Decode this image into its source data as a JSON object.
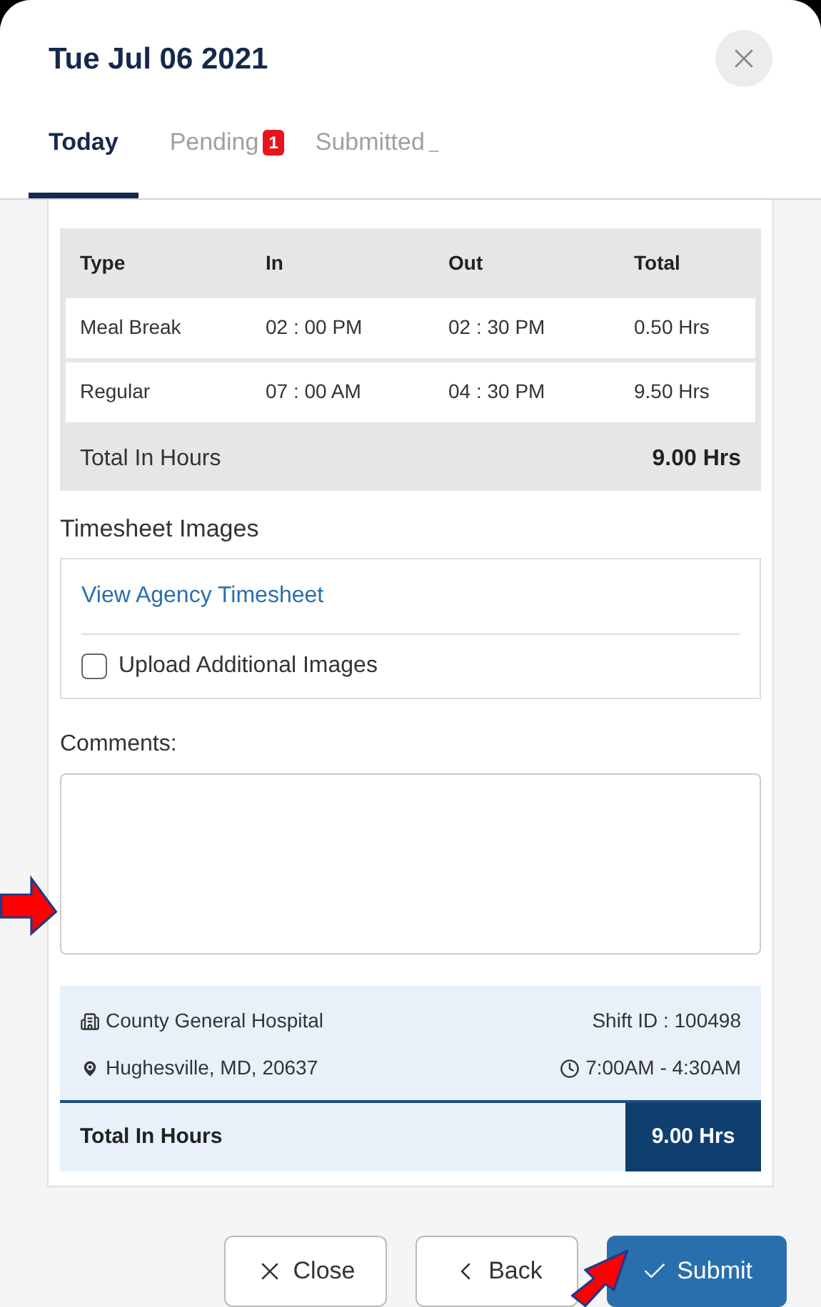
{
  "dialog": {
    "title": "Tue Jul 06 2021"
  },
  "tabs": [
    {
      "label": "Today",
      "selected": true
    },
    {
      "label": "Pending",
      "selected": false,
      "badge": "1"
    },
    {
      "label": "Submitted",
      "selected": false,
      "badge": "_"
    }
  ],
  "table": {
    "columns": [
      "Type",
      "In",
      "Out",
      "Total"
    ],
    "rows": [
      [
        "Meal Break",
        "02 : 00 PM",
        "02 : 30 PM",
        "0.50 Hrs"
      ],
      [
        "Regular",
        "07 : 00 AM",
        "04 : 30 PM",
        "9.50 Hrs"
      ]
    ],
    "footer": {
      "label": "Total In Hours",
      "value": "9.00 Hrs"
    }
  },
  "timesheet_images": {
    "heading": "Timesheet Images",
    "link": "View Agency Timesheet",
    "upload": {
      "label": "Upload Additional Images",
      "checked": false
    }
  },
  "comments": {
    "label": "Comments:"
  },
  "shift": {
    "facility": "County General Hospital",
    "shift_id": "Shift ID : 100498",
    "location": "Hughesville, MD, 20637",
    "time": "7:00AM - 4:30AM",
    "total_label": "Total In Hours",
    "total_value": "9.00 Hrs"
  },
  "buttons": [
    {
      "kind": "close",
      "label": "Close"
    },
    {
      "kind": "back",
      "label": "Back"
    },
    {
      "kind": "submit",
      "label": "Submit"
    }
  ]
}
